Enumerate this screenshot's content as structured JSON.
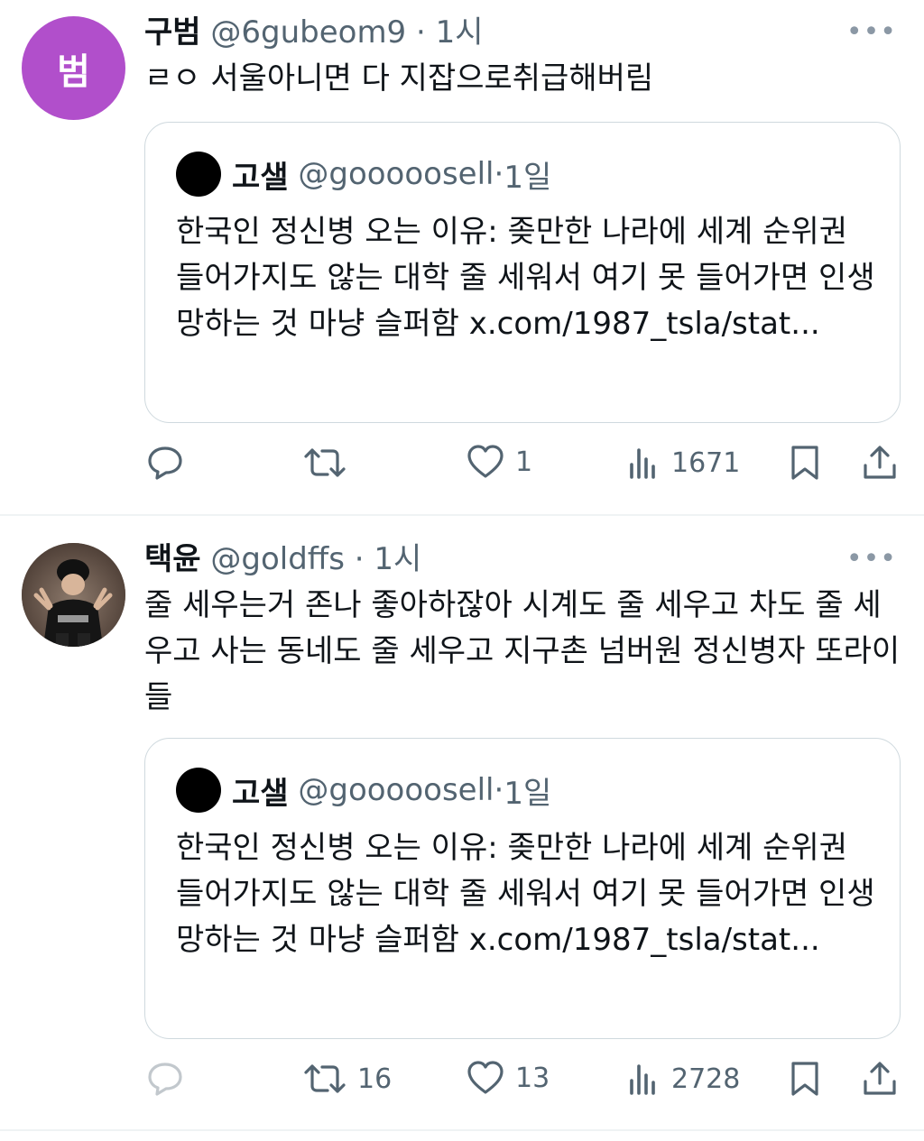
{
  "tweets": [
    {
      "avatar_text": "범",
      "name": "구범",
      "handle": "@6gubeom9",
      "sep": " · ",
      "time": "1시",
      "text": "ㄹㅇ 서울아니면 다 지잡으로취급해버림",
      "quote": {
        "name": "고샐",
        "handle": "@gooooosell",
        "sep": " · ",
        "time": "1일",
        "text": "한국인 정신병 오는 이유: 좆만한 나라에 세계 순위권 들어가지도 않는 대학 줄 세워서 여기 못 들어가면 인생 망하는 것 마냥 슬퍼함 x.com/1987_tsla/stat..."
      },
      "actions": {
        "reply": "",
        "retweet": "",
        "like": "1",
        "views": "1671"
      }
    },
    {
      "name": "택윤",
      "handle": "@goldffs",
      "sep": " · ",
      "time": "1시",
      "text": "줄 세우는거 존나 좋아하잖아 시계도 줄 세우고 차도 줄 세우고 사는 동네도 줄 세우고 지구촌 넘버원 정신병자 또라이들",
      "quote": {
        "name": "고샐",
        "handle": "@gooooosell",
        "sep": " · ",
        "time": "1일",
        "text": "한국인 정신병 오는 이유: 좆만한 나라에 세계 순위권 들어가지도 않는 대학 줄 세워서 여기 못 들어가면 인생 망하는 것 마냥 슬퍼함 x.com/1987_tsla/stat..."
      },
      "actions": {
        "reply": "",
        "retweet": "16",
        "like": "13",
        "views": "2728"
      }
    }
  ],
  "more_label": "•••",
  "colors": {
    "secondary": "#536471",
    "border": "#cfd9de",
    "avatar_purple": "#b14fcb"
  },
  "icons": [
    "reply-icon",
    "retweet-icon",
    "like-icon",
    "views-icon",
    "bookmark-icon",
    "share-icon",
    "more-icon"
  ]
}
